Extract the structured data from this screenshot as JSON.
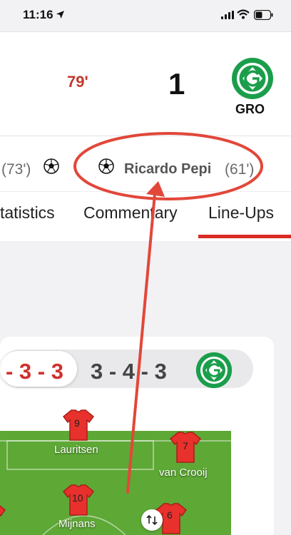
{
  "status_bar": {
    "time": "11:16"
  },
  "header": {
    "minute": "79'",
    "score": "1",
    "team_abbr": "GRO"
  },
  "goals": {
    "first_minute": "(73')",
    "scorer": "Ricardo Pepi",
    "scorer_minute": "(61')"
  },
  "tabs": [
    {
      "label": "tatistics"
    },
    {
      "label": "Commentary"
    },
    {
      "label": "Line-Ups"
    }
  ],
  "lineups": {
    "home_formation": "- 3 - 3",
    "away_formation": "3 - 4 - 3",
    "players": [
      {
        "number": "9",
        "name": "Lauritsen"
      },
      {
        "number": "7",
        "name": "van Crooij"
      },
      {
        "number": "10",
        "name": "Mijnans"
      },
      {
        "number": "6",
        "name": ""
      }
    ]
  },
  "colors": {
    "accent": "#d92b24",
    "team_green": "#1b9e4b",
    "pitch": "#5ea836"
  }
}
